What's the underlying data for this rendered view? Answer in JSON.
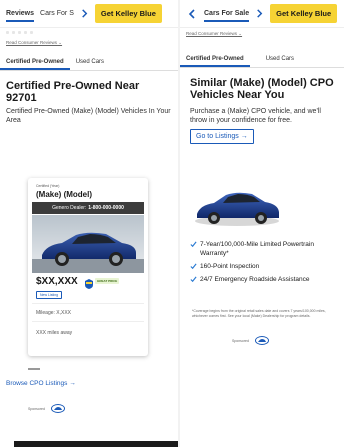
{
  "left": {
    "nav": {
      "tab_reviews": "Reviews",
      "tab_cars_for_sale": "Cars For S",
      "cta": "Get Kelley Blue"
    },
    "read_reviews": "Read Consumer Reviews",
    "subtabs": [
      "Certified Pre-Owned",
      "Used Cars"
    ],
    "heading": "Certified Pre-Owned Near 92701",
    "subheading": "Certified Pre-Owned (Make) (Model) Vehicles In Your Area",
    "card": {
      "certified_year": "Certified (Year)",
      "make_model": "(Make) (Model)",
      "dealer_prefix": "Genero Dealer:",
      "dealer_phone": "1-800-000-0000",
      "price": "$XX,XXX",
      "great_price": "GREAT PRICE",
      "new_listing": "New Listing",
      "mileage": "Mileage: X,XXX",
      "distance": "XXX miles away"
    },
    "browse_link": "Browse CPO Listings →",
    "sponsored": "Sponsored"
  },
  "right": {
    "nav": {
      "tab_cars_for_sale": "Cars For Sale",
      "cta": "Get Kelley Blue"
    },
    "read_reviews": "Read Consumer Reviews",
    "subtabs": [
      "Certified Pre-Owned",
      "Used Cars"
    ],
    "heading": "Similar (Make) (Model) CPO Vehicles Near You",
    "body": "Purchase a (Make) CPO vehicle, and we'll throw in your confidence for free.",
    "goto_button": "Go to Listings →",
    "checklist": [
      "7-Year/100,000-Mile Limited Powertrain Warranty*",
      "160-Point Inspection",
      "24/7 Emergency Roadside Assistance"
    ],
    "fine_print": "*Coverage begins from the original retail sales date and covers 7 years/100,000 miles, whichever comes first. See your local (Make) Dealership for program details.",
    "sponsored": "Sponsored"
  },
  "colors": {
    "accent_blue": "#1a5ab8",
    "cta_yellow": "#f6d334",
    "check_blue": "#2a7ad2"
  }
}
